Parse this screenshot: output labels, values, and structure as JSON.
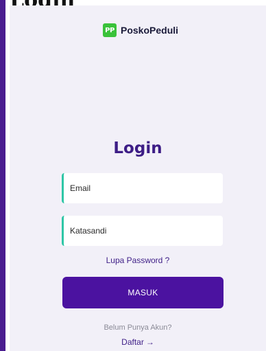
{
  "clipped_heading": "Login",
  "brand": {
    "logo_text": "PP",
    "name": "PoskoPeduli"
  },
  "login": {
    "title": "Login",
    "email_placeholder": "Email",
    "password_placeholder": "Katasandi",
    "forgot_password": "Lupa Password ?",
    "submit_label": "MASUK",
    "no_account_text": "Belum Punya Akun?",
    "register_label": "Daftar",
    "register_arrow": "→"
  },
  "colors": {
    "accent_purple": "#4b12a0",
    "title_purple": "#3d1d86",
    "field_accent": "#2fc6a6",
    "logo_green": "#3ac23a",
    "background": "#f2f0f8"
  }
}
